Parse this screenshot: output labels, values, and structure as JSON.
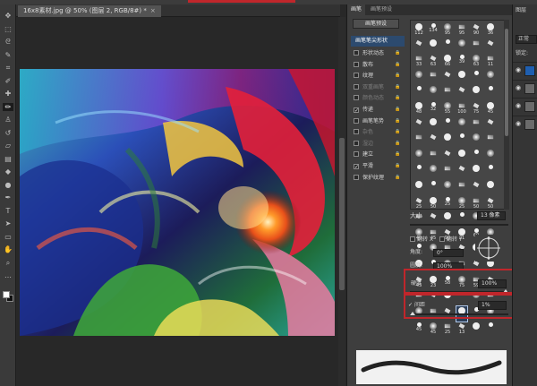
{
  "document": {
    "tab_title": "16x8素材.jpg @ 50% (图层 2, RGB/8#) *",
    "close_glyph": "×"
  },
  "toolbox": {
    "tools": [
      {
        "icon": "move-icon",
        "glyph": "✥"
      },
      {
        "icon": "marquee-icon",
        "glyph": "⬚"
      },
      {
        "icon": "lasso-icon",
        "glyph": "ᘓ"
      },
      {
        "icon": "quick-select-icon",
        "glyph": "✎"
      },
      {
        "icon": "crop-icon",
        "glyph": "⌗"
      },
      {
        "icon": "eyedropper-icon",
        "glyph": "✐"
      },
      {
        "icon": "healing-icon",
        "glyph": "✚"
      },
      {
        "icon": "brush-icon",
        "glyph": "✏"
      },
      {
        "icon": "stamp-icon",
        "glyph": "♙"
      },
      {
        "icon": "history-brush-icon",
        "glyph": "↺"
      },
      {
        "icon": "eraser-icon",
        "glyph": "▱"
      },
      {
        "icon": "gradient-icon",
        "glyph": "▤"
      },
      {
        "icon": "blur-icon",
        "glyph": "◆"
      },
      {
        "icon": "dodge-icon",
        "glyph": "●"
      },
      {
        "icon": "pen-icon",
        "glyph": "✒"
      },
      {
        "icon": "type-icon",
        "glyph": "T"
      },
      {
        "icon": "path-select-icon",
        "glyph": "➤"
      },
      {
        "icon": "shape-icon",
        "glyph": "▭"
      },
      {
        "icon": "hand-icon",
        "glyph": "✋"
      },
      {
        "icon": "zoom-icon",
        "glyph": "⌕"
      },
      {
        "icon": "extras-icon",
        "glyph": "…"
      }
    ],
    "active_index": 7,
    "fg_color": "#ffffff",
    "bg_color": "#111111"
  },
  "brush_panel": {
    "tabs": [
      "画笔",
      "画笔预设"
    ],
    "presets_button": "画笔预设",
    "tip_shape_label": "画笔笔尖形状",
    "options": [
      {
        "label": "形状动态",
        "checked": false,
        "dim": false
      },
      {
        "label": "散布",
        "checked": false,
        "dim": false
      },
      {
        "label": "纹理",
        "checked": false,
        "dim": false
      },
      {
        "label": "双重画笔",
        "checked": false,
        "dim": true
      },
      {
        "label": "颜色动态",
        "checked": false,
        "dim": true
      },
      {
        "label": "传递",
        "checked": true,
        "dim": false
      },
      {
        "label": "画笔笔势",
        "checked": false,
        "dim": false
      },
      {
        "label": "杂色",
        "checked": false,
        "dim": true
      },
      {
        "label": "湿边",
        "checked": false,
        "dim": true
      },
      {
        "label": "建立",
        "checked": false,
        "dim": false
      },
      {
        "label": "平滑",
        "checked": true,
        "dim": false
      },
      {
        "label": "保护纹理",
        "checked": false,
        "dim": false
      }
    ],
    "brush_tip_numbers": [
      "112",
      "134",
      "95",
      "95",
      "90",
      "36",
      "",
      "",
      "",
      "",
      "",
      "",
      "33",
      "63",
      "66",
      "39",
      "63",
      "11",
      "",
      "",
      "",
      "",
      "",
      "",
      "",
      "",
      "",
      "",
      "",
      "",
      "48",
      "32",
      "55",
      "100",
      "75",
      "45",
      "",
      "",
      "",
      "",
      "",
      "",
      "",
      "",
      "",
      "",
      "",
      "",
      "",
      "",
      "",
      "",
      "",
      "",
      "",
      "",
      "",
      "",
      "",
      "",
      "",
      "",
      "",
      "",
      "",
      "",
      "25",
      "50",
      "25",
      "25",
      "50",
      "50",
      "",
      "",
      "",
      "",
      "",
      "",
      "40",
      "45",
      "90",
      "21",
      "60",
      "14",
      "",
      "",
      "",
      "",
      "",
      "",
      "",
      "",
      "",
      "",
      "",
      "",
      "43",
      "23",
      "58",
      "75",
      "59",
      "25",
      "",
      "",
      "",
      "",
      "",
      "",
      "",
      "",
      "",
      "",
      "",
      "",
      "45",
      "45",
      "25",
      "13",
      "",
      ""
    ],
    "selected_tip_index": 111,
    "size_label": "大小",
    "size_value": "13 像素",
    "flip_x": "翻转 X",
    "flip_y": "翻转 Y",
    "angle_label": "角度:",
    "angle_value": "0°",
    "roundness_label": "圆度:",
    "roundness_value": "100%",
    "hardness_label": "硬度",
    "hardness_value": "100%",
    "spacing_label": "间距",
    "spacing_value": "1%",
    "spacing_checked": true
  },
  "right_panel": {
    "top_label": "图层",
    "mode": "正常",
    "lock_label": "锁定:",
    "layer_count": 4
  },
  "colors": {
    "highlight_red": "#c0262b",
    "panel_bg": "#3e3e3e",
    "workspace_bg": "#282828",
    "preview_bg": "#f1f1f1"
  }
}
